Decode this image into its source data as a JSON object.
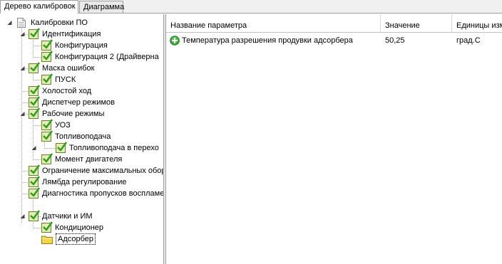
{
  "tabs": [
    {
      "label": "Дерево калибровок",
      "active": true
    },
    {
      "label": "Диаграмма",
      "active": false
    }
  ],
  "tree": {
    "root": {
      "label": "Калибровки ПО"
    },
    "nodes": [
      {
        "label": "Идентификация"
      },
      {
        "label": "Конфигурация"
      },
      {
        "label": "Конфигурация 2 (Драйверна"
      },
      {
        "label": "Маска ошибок"
      },
      {
        "label": "ПУСК"
      },
      {
        "label": "Холостой ход"
      },
      {
        "label": "Диспетчер режимов"
      },
      {
        "label": "Рабочие режимы"
      },
      {
        "label": "УОЗ"
      },
      {
        "label": "Топливоподача"
      },
      {
        "label": "Топливоподача в перехо"
      },
      {
        "label": "Момент двигателя"
      },
      {
        "label": "Ограничение максимальных обор"
      },
      {
        "label": "Лямбда регулирование"
      },
      {
        "label": "Диагностика пропусков воспламе"
      },
      {
        "label": "Датчики и ИМ"
      },
      {
        "label": "Кондиционер"
      },
      {
        "label": "Адсорбер",
        "selected": true
      }
    ]
  },
  "grid": {
    "columns": [
      "Название параметра",
      "Значение",
      "Единицы изм"
    ],
    "rows": [
      {
        "name": "Температура разрешения продувки адсорбера",
        "value": "50,25",
        "unit": "град.С",
        "icon": "plus-circle-icon"
      }
    ]
  },
  "colors": {
    "check_fill": "#e3ecb6",
    "check_border": "#6a7f23",
    "check_mark": "#33a01c",
    "folder": "#f6d54a",
    "plus_icon": "#3aa63a"
  }
}
